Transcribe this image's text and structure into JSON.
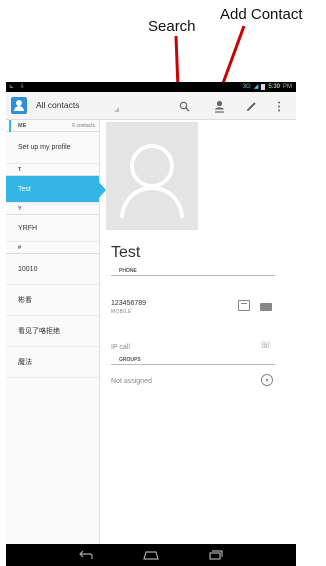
{
  "annotations": {
    "search": "Search",
    "add_contact": "Add Contact"
  },
  "status_bar": {
    "network": "3G",
    "time": "5:39",
    "ampm": "PM"
  },
  "action_bar": {
    "title": "All contacts",
    "icons": [
      "search-icon",
      "add-contact-icon",
      "edit-icon",
      "overflow-menu-icon"
    ]
  },
  "sidebar": {
    "me_header": "ME",
    "me_count": "6 contacts",
    "profile_row": "Set up my profile",
    "sections": [
      {
        "header": "T",
        "items": [
          "Test"
        ]
      },
      {
        "header": "Y",
        "items": [
          "YRFH"
        ]
      },
      {
        "header": "#",
        "items": [
          "10010",
          "彬看",
          "看见了咯拒绝",
          "魔法"
        ]
      }
    ],
    "selected": "Test"
  },
  "detail": {
    "name": "Test",
    "phone_section": "PHONE",
    "phone_number": "123456789",
    "phone_type": "MOBILE",
    "ip_call": "IP call",
    "groups_section": "GROUPS",
    "groups_value": "Not assigned"
  },
  "colors": {
    "accent": "#33b5e5",
    "annotation_arrow": "#cc0000"
  }
}
